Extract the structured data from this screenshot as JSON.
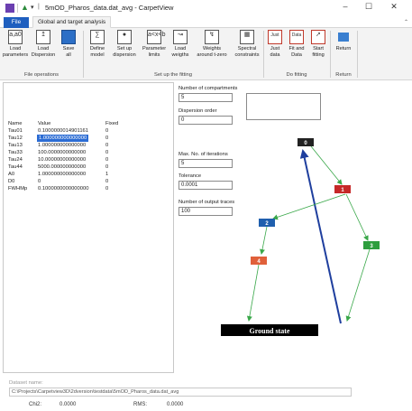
{
  "window": {
    "title": "5mOD_Pharos_data.dat_avg - CarpetView",
    "minimize": "–",
    "maximize": "☐",
    "close": "✕"
  },
  "tabs": {
    "file": "File",
    "global": "Global and target analysis"
  },
  "ribbon": {
    "buttons": {
      "load_parameters": [
        "Load",
        "parameters"
      ],
      "load_dispersion": [
        "Load",
        "Dispersion"
      ],
      "save_all": [
        "Save",
        "all"
      ],
      "define_model": [
        "Define",
        "model"
      ],
      "set_up_dispersion": [
        "Set up",
        "dispersion"
      ],
      "parameter_limits": [
        "Parameter",
        "limits"
      ],
      "load_weights": [
        "Load",
        "weigths"
      ],
      "weights_t_zero": [
        "Weights",
        "around t-zero"
      ],
      "spectral_constraints": [
        "Spectral",
        "constraints"
      ],
      "just_data": [
        "Just",
        "data"
      ],
      "fit_and_data": [
        "Fit and",
        "Data"
      ],
      "start_fitting": [
        "Start",
        "fitting"
      ],
      "return": [
        "Return",
        ""
      ]
    },
    "groups": {
      "file_operations": "File operations",
      "set_up_fitting": "Set up the fitting",
      "do_fitting": "Do fitting",
      "return": "Return"
    }
  },
  "params_table": {
    "headers": [
      "Name",
      "Value",
      "Fixed"
    ],
    "rows": [
      [
        "Tau01",
        "0.1000000014901161",
        "0"
      ],
      [
        "Tau12",
        "1.000000000000000",
        "0"
      ],
      [
        "Tau13",
        "1.000000000000000",
        "0"
      ],
      [
        "Tau33",
        "100.0000000000000",
        "0"
      ],
      [
        "Tau24",
        "10.00000000000000",
        "0"
      ],
      [
        "Tau44",
        "5000.000000000000",
        "0"
      ],
      [
        "A0",
        "1.000000000000000",
        "1"
      ],
      [
        "D0",
        "0",
        "0"
      ],
      [
        "FWHMp",
        "0.1000000000000000",
        "0"
      ]
    ]
  },
  "settings": {
    "num_compartments_label": "Number of compartments",
    "num_compartments": "5",
    "dispersion_order_label": "Dispersion order",
    "dispersion_order": "0",
    "max_iterations_label": "Max. No. of iterations",
    "max_iterations": "5",
    "tolerance_label": "Tolerance",
    "tolerance": "0.0001",
    "output_traces_label": "Number of output traces",
    "output_traces": "100"
  },
  "diagram": {
    "nodes": [
      {
        "label": "0",
        "color": "#222222"
      },
      {
        "label": "1",
        "color": "#c62828"
      },
      {
        "label": "2",
        "color": "#1f5fae"
      },
      {
        "label": "3",
        "color": "#2e9e3e"
      },
      {
        "label": "4",
        "color": "#e0603a"
      }
    ],
    "ground_state": "Ground state",
    "arrow_color": "#3aa84a",
    "excitation_color": "#1f3f9e"
  },
  "dataset": {
    "label": "Dataset name:",
    "path": "C:\\Projects\\Carpetview3D\\2dversion\\testdata\\5mOD_Pharos_data.dat_avg"
  },
  "footer": {
    "chi2_label": "Chi2:",
    "chi2_value": "0.0000",
    "rms_label": "RMS:",
    "rms_value": "0.0000"
  }
}
